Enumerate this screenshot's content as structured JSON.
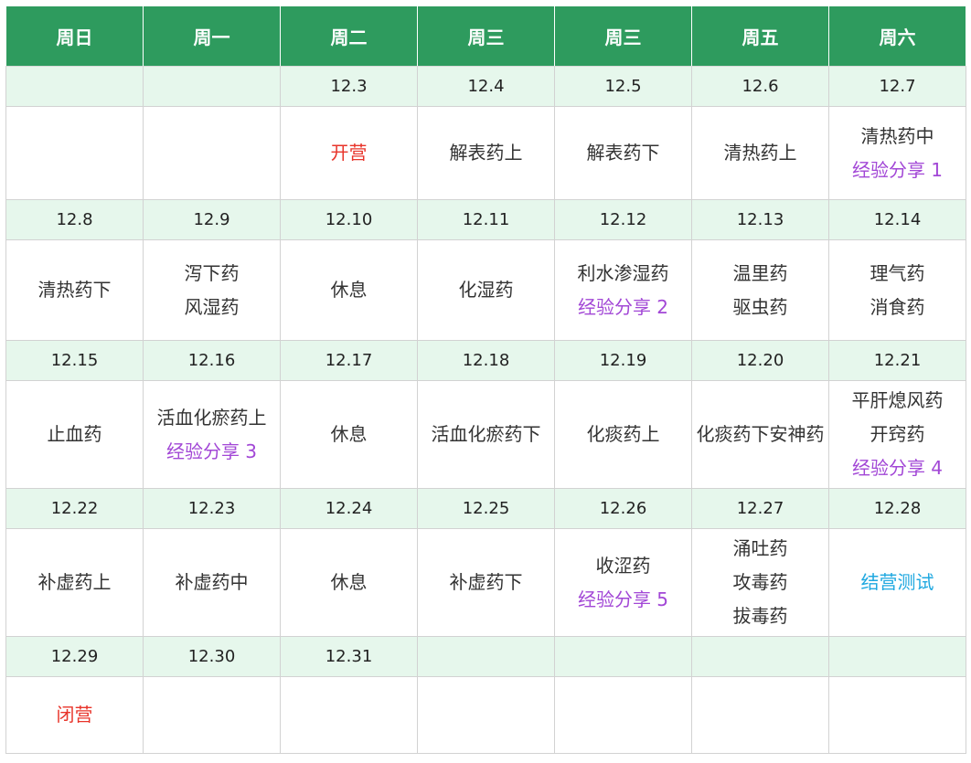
{
  "headers": [
    "周日",
    "周一",
    "周二",
    "周三",
    "周三",
    "周五",
    "周六"
  ],
  "weeks": [
    {
      "dates": [
        "",
        "",
        "12.3",
        "12.4",
        "12.5",
        "12.6",
        "12.7"
      ],
      "cells": [
        [],
        [],
        [
          {
            "text": "开营",
            "style": "red"
          }
        ],
        [
          {
            "text": "解表药上"
          }
        ],
        [
          {
            "text": "解表药下"
          }
        ],
        [
          {
            "text": "清热药上"
          }
        ],
        [
          {
            "text": "清热药中"
          },
          {
            "text": "经验分享 1",
            "style": "purple"
          }
        ]
      ]
    },
    {
      "dates": [
        "12.8",
        "12.9",
        "12.10",
        "12.11",
        "12.12",
        "12.13",
        "12.14"
      ],
      "cells": [
        [
          {
            "text": "清热药下"
          }
        ],
        [
          {
            "text": "泻下药"
          },
          {
            "text": "风湿药"
          }
        ],
        [
          {
            "text": "休息"
          }
        ],
        [
          {
            "text": "化湿药"
          }
        ],
        [
          {
            "text": "利水渗湿药"
          },
          {
            "text": "经验分享 2",
            "style": "purple"
          }
        ],
        [
          {
            "text": "温里药"
          },
          {
            "text": "驱虫药"
          }
        ],
        [
          {
            "text": "理气药"
          },
          {
            "text": "消食药"
          }
        ]
      ]
    },
    {
      "dates": [
        "12.15",
        "12.16",
        "12.17",
        "12.18",
        "12.19",
        "12.20",
        "12.21"
      ],
      "cells": [
        [
          {
            "text": "止血药"
          }
        ],
        [
          {
            "text": "活血化瘀药上"
          },
          {
            "text": "经验分享 3",
            "style": "purple"
          }
        ],
        [
          {
            "text": "休息"
          }
        ],
        [
          {
            "text": "活血化瘀药下"
          }
        ],
        [
          {
            "text": "化痰药上"
          }
        ],
        [
          {
            "text": "化痰药下安神药"
          }
        ],
        [
          {
            "text": "平肝熄风药"
          },
          {
            "text": "开窍药"
          },
          {
            "text": "经验分享 4",
            "style": "purple"
          }
        ]
      ]
    },
    {
      "dates": [
        "12.22",
        "12.23",
        "12.24",
        "12.25",
        "12.26",
        "12.27",
        "12.28"
      ],
      "cells": [
        [
          {
            "text": "补虚药上"
          }
        ],
        [
          {
            "text": "补虚药中"
          }
        ],
        [
          {
            "text": "休息"
          }
        ],
        [
          {
            "text": "补虚药下"
          }
        ],
        [
          {
            "text": "收涩药"
          },
          {
            "text": "经验分享 5",
            "style": "purple"
          }
        ],
        [
          {
            "text": "涌吐药"
          },
          {
            "text": "攻毒药"
          },
          {
            "text": "拔毒药"
          }
        ],
        [
          {
            "text": "结营测试",
            "style": "blue"
          }
        ]
      ]
    },
    {
      "dates": [
        "12.29",
        "12.30",
        "12.31",
        "",
        "",
        "",
        ""
      ],
      "cells": [
        [
          {
            "text": "闭营",
            "style": "red"
          }
        ],
        [],
        [],
        [],
        [],
        [],
        []
      ]
    }
  ],
  "colors": {
    "header_bg": "#2e9b5e",
    "date_row_bg": "#e6f7ec",
    "red": "#e8342a",
    "purple": "#a247d6",
    "blue": "#1fa8e0"
  }
}
